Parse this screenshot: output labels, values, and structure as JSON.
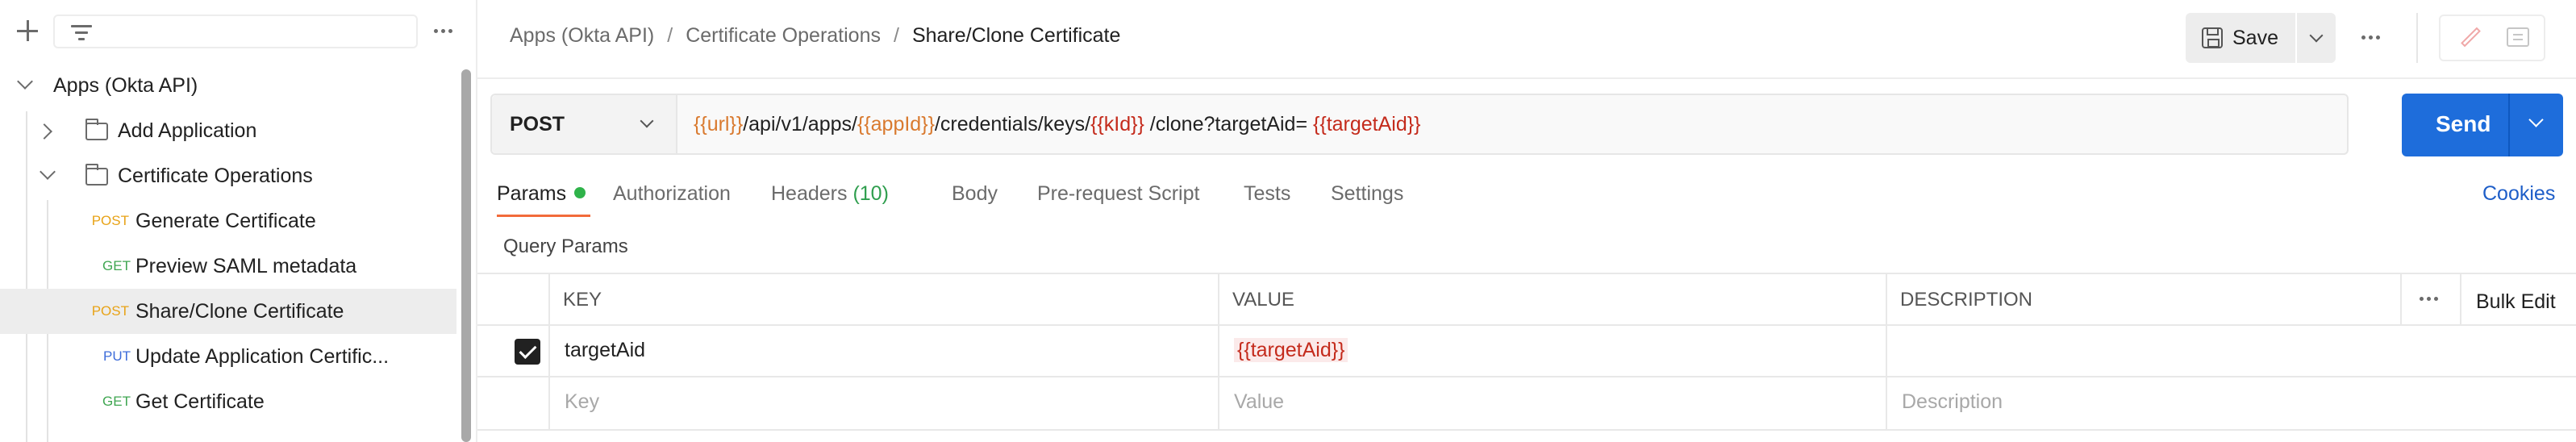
{
  "sidebar": {
    "tree": [
      {
        "label": "Apps (Okta API)",
        "type": "collection",
        "expanded": true
      },
      {
        "label": "Add Application",
        "type": "folder",
        "expanded": false
      },
      {
        "label": "Certificate Operations",
        "type": "folder",
        "expanded": true
      },
      {
        "method": "POST",
        "label": "Generate Certificate"
      },
      {
        "method": "GET",
        "label": "Preview SAML metadata"
      },
      {
        "method": "POST",
        "label": "Share/Clone Certificate",
        "active": true
      },
      {
        "method": "PUT",
        "label": "Update Application Certific..."
      },
      {
        "method": "GET",
        "label": "Get Certificate"
      }
    ]
  },
  "header": {
    "breadcrumb": [
      "Apps (Okta API)",
      "Certificate Operations",
      "Share/Clone Certificate"
    ],
    "save_label": "Save"
  },
  "request": {
    "method": "POST",
    "url_parts": [
      {
        "text": "{{url}}",
        "kind": "var-or"
      },
      {
        "text": "/api/v1/apps/",
        "kind": "plain"
      },
      {
        "text": "{{appId}}",
        "kind": "var-or"
      },
      {
        "text": "/credentials/keys/",
        "kind": "plain"
      },
      {
        "text": "{{kId}}",
        "kind": "var-red"
      },
      {
        "text": "/clone?targetAid=",
        "kind": "plain"
      },
      {
        "text": "{{targetAid}}",
        "kind": "var-red"
      }
    ],
    "send_label": "Send"
  },
  "tabs": [
    {
      "label": "Params",
      "active": true,
      "dot": true
    },
    {
      "label": "Authorization"
    },
    {
      "label": "Headers",
      "count": "(10)"
    },
    {
      "label": "Body"
    },
    {
      "label": "Pre-request Script"
    },
    {
      "label": "Tests"
    },
    {
      "label": "Settings"
    }
  ],
  "cookies_label": "Cookies",
  "query_params": {
    "title": "Query Params",
    "headers": {
      "key": "KEY",
      "value": "VALUE",
      "description": "DESCRIPTION"
    },
    "bulk_edit": "Bulk Edit",
    "rows": [
      {
        "checked": true,
        "key": "targetAid",
        "value": "{{targetAid}}",
        "description": ""
      }
    ],
    "placeholder": {
      "key": "Key",
      "value": "Value",
      "description": "Description"
    }
  },
  "colors": {
    "accent": "#1e6ddb",
    "tab_underline": "#f26b3a",
    "post": "#e8a317",
    "get": "#3fa651",
    "put": "#3d6cd9"
  }
}
